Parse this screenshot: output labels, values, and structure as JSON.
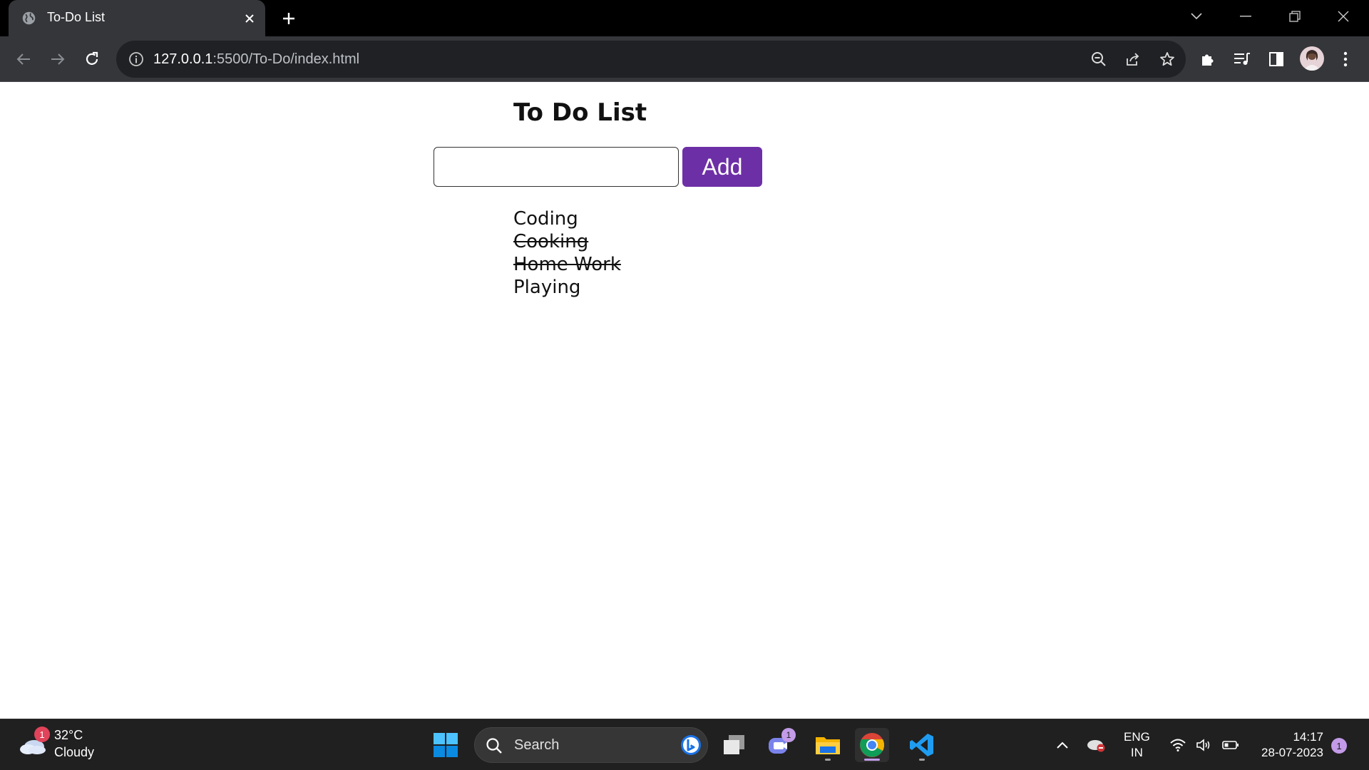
{
  "browser": {
    "tab_title": "To-Do List",
    "tab_favicon": "globe-icon",
    "url_host": "127.0.0.1",
    "url_rest": ":5500/To-Do/index.html"
  },
  "page": {
    "title": "To Do List",
    "input_value": "",
    "add_label": "Add",
    "tasks": [
      {
        "label": "Coding",
        "done": false
      },
      {
        "label": "Cooking",
        "done": true
      },
      {
        "label": "Home Work",
        "done": true
      },
      {
        "label": "Playing",
        "done": false
      }
    ],
    "accent_color": "#6d2fa6"
  },
  "taskbar": {
    "weather_temp": "32°C",
    "weather_condition": "Cloudy",
    "weather_badge": "1",
    "search_label": "Search",
    "chat_badge": "1",
    "lang_line1": "ENG",
    "lang_line2": "IN",
    "time": "14:17",
    "date": "28-07-2023",
    "notification_count": "1"
  }
}
